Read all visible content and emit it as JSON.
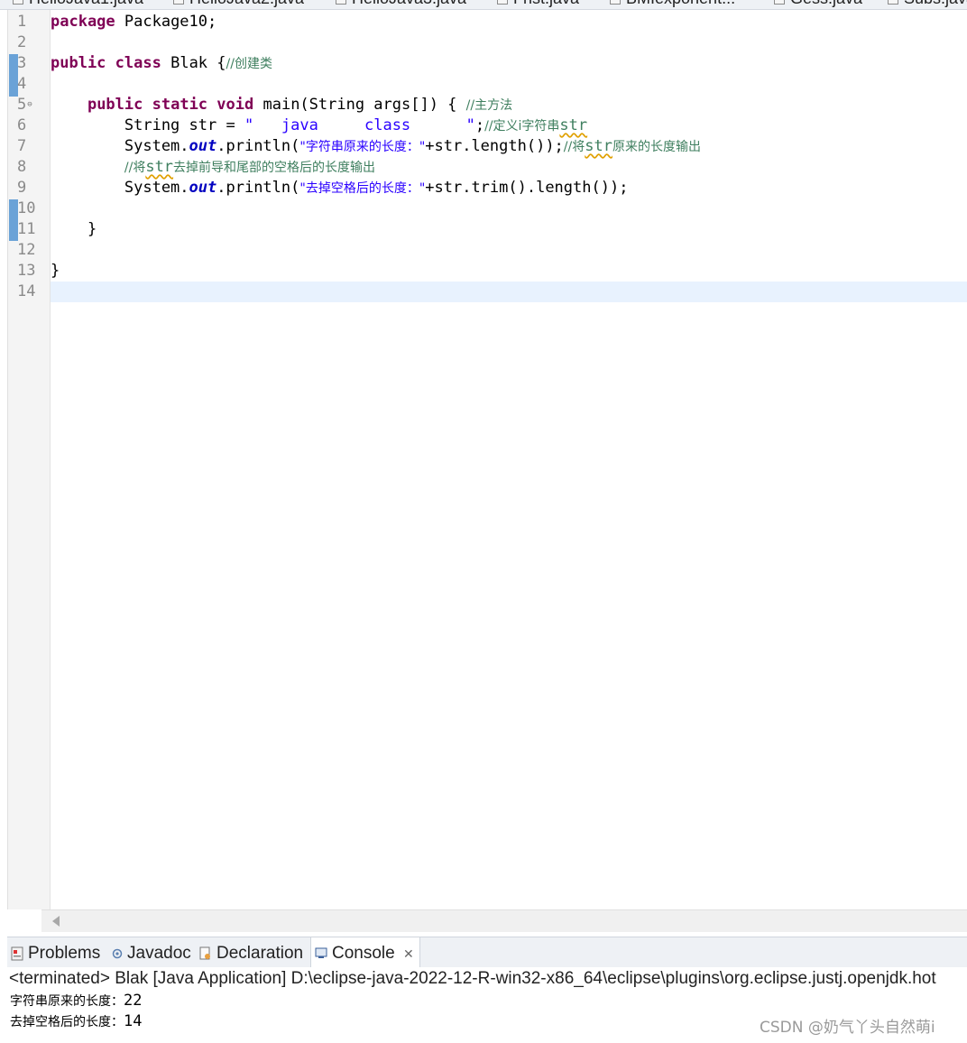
{
  "editor_tabs": [
    "HelloJava1.java",
    "HelloJava2.java",
    "HelloJava3.java",
    "Frist.java",
    "BMIexponent...",
    "Gess.java",
    "Subs.java"
  ],
  "line_numbers": [
    "1",
    "2",
    "3",
    "4",
    "5",
    "6",
    "7",
    "8",
    "9",
    "10",
    "11",
    "12",
    "13",
    "14"
  ],
  "fold_marker": "⊖",
  "code": {
    "l1_kw": "package",
    "l1_rest": " Package10;",
    "l3_kw1": "public",
    "l3_kw2": "class",
    "l3_rest": " Blak {",
    "l3_cm": "//创建类",
    "l5_indent": "    ",
    "l5_kw1": "public",
    "l5_kw2": "static",
    "l5_kw3": "void",
    "l5_rest": " main(String args[]) {",
    "l5_cm": "//主方法",
    "l6_pre": "        String str = ",
    "l6_str": "\"   java     class      \"",
    "l6_semi": ";",
    "l6_cm1": "//定义i字符串",
    "l6_cm2": "str",
    "l7_pre": "        System.",
    "l7_out": "out",
    "l7_mid": ".println(",
    "l7_str": "\"字符串原来的长度：\"",
    "l7_rest": "+str.length());",
    "l7_cm1": "//将",
    "l7_cm2": "str",
    "l7_cm3": "原来的长度输出",
    "l8_indent": "        ",
    "l8_cm1": "//将",
    "l8_cm2": "str",
    "l8_cm3": "去掉前导和尾部的空格后的长度输出",
    "l9_pre": "        System.",
    "l9_out": "out",
    "l9_mid": ".println(",
    "l9_str": "\"去掉空格后的长度：\"",
    "l9_rest": "+str.trim().length());",
    "l11": "    }",
    "l13": "}"
  },
  "views": {
    "problems": "Problems",
    "javadoc": "Javadoc",
    "declaration": "Declaration",
    "console": "Console",
    "close": "✕"
  },
  "console": {
    "description": "<terminated> Blak [Java Application] D:\\eclipse-java-2022-12-R-win32-x86_64\\eclipse\\plugins\\org.eclipse.justj.openjdk.hot",
    "out1_label": "字符串原来的长度：",
    "out1_value": "22",
    "out2_label": "去掉空格后的长度：",
    "out2_value": "14"
  },
  "watermark": "CSDN @奶气丫头自然萌i",
  "colors": {
    "keyword": "#7f0055",
    "string": "#2a00ff",
    "comment": "#3f7f5f",
    "field": "#0000c0",
    "current_line": "#e8f2fe",
    "quick_diff": "#6aa2d7"
  }
}
